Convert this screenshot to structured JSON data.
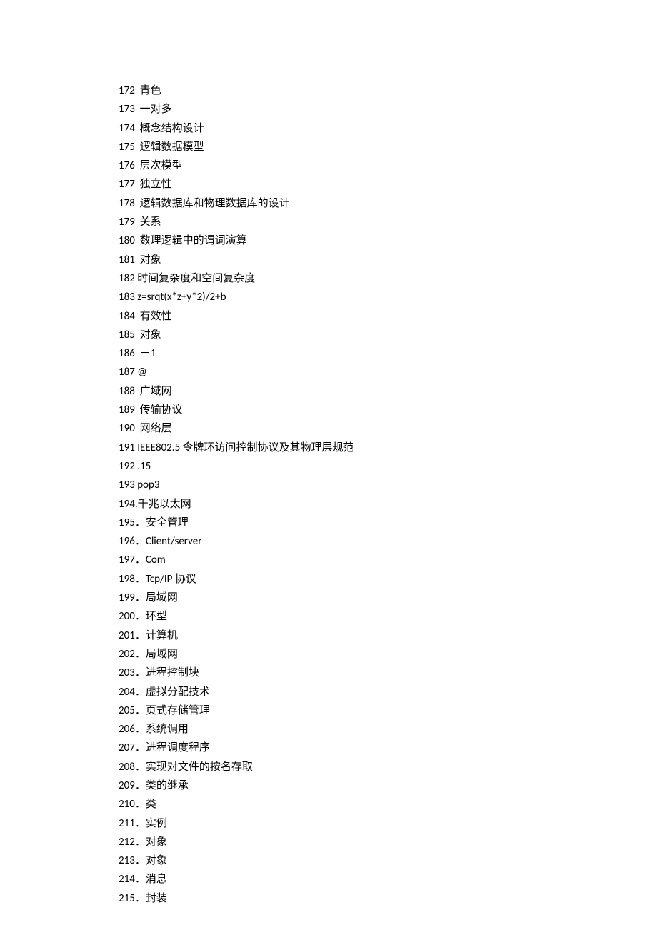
{
  "items": [
    {
      "num": "172",
      "sep": "  ",
      "text": "青色"
    },
    {
      "num": "173",
      "sep": "  ",
      "text": "一对多"
    },
    {
      "num": "174",
      "sep": "  ",
      "text": "概念结构设计"
    },
    {
      "num": "175",
      "sep": "  ",
      "text": "逻辑数据模型"
    },
    {
      "num": "176",
      "sep": "  ",
      "text": "层次模型"
    },
    {
      "num": "177",
      "sep": "  ",
      "text": "独立性"
    },
    {
      "num": "178",
      "sep": "  ",
      "text": "逻辑数据库和物理数据库的设计"
    },
    {
      "num": "179",
      "sep": "  ",
      "text": "关系"
    },
    {
      "num": "180",
      "sep": "  ",
      "text": "数理逻辑中的谓词演算"
    },
    {
      "num": "181",
      "sep": "  ",
      "text": "对象"
    },
    {
      "num": "182",
      "sep": " ",
      "text": "时间复杂度和空间复杂度"
    },
    {
      "num": "183",
      "sep": " ",
      "text": "z=srqt(x*z+y*2)/2+b"
    },
    {
      "num": "184",
      "sep": "  ",
      "text": "有效性"
    },
    {
      "num": "185",
      "sep": "  ",
      "text": "对象"
    },
    {
      "num": "186",
      "sep": "  ",
      "text": "－1"
    },
    {
      "num": "187",
      "sep": " ",
      "text": "@"
    },
    {
      "num": "188",
      "sep": "  ",
      "text": "广域网"
    },
    {
      "num": "189",
      "sep": "  ",
      "text": "传输协议"
    },
    {
      "num": "190",
      "sep": "  ",
      "text": "网络层"
    },
    {
      "num": "191",
      "sep": " ",
      "text": "IEEE802.5 令牌环访问控制协议及其物理层规范"
    },
    {
      "num": "192",
      "sep": " ",
      "text": ".15"
    },
    {
      "num": "193",
      "sep": " ",
      "text": "pop3"
    },
    {
      "num": "194",
      "sep": ".",
      "text": "千兆以太网"
    },
    {
      "num": "195",
      "sep": "．",
      "text": "安全管理"
    },
    {
      "num": "196",
      "sep": "．",
      "text": "Client/server"
    },
    {
      "num": "197",
      "sep": "．",
      "text": "Com"
    },
    {
      "num": "198",
      "sep": "．",
      "text": "Tcp/IP 协议"
    },
    {
      "num": "199",
      "sep": "．",
      "text": "局域网"
    },
    {
      "num": "200",
      "sep": "．",
      "text": "环型"
    },
    {
      "num": "201",
      "sep": "．",
      "text": "计算机"
    },
    {
      "num": "202",
      "sep": "．",
      "text": "局域网"
    },
    {
      "num": "203",
      "sep": "．",
      "text": "进程控制块"
    },
    {
      "num": "204",
      "sep": "．",
      "text": "虚拟分配技术"
    },
    {
      "num": "205",
      "sep": "．",
      "text": "页式存储管理"
    },
    {
      "num": "206",
      "sep": "．",
      "text": "系统调用"
    },
    {
      "num": "207",
      "sep": "．",
      "text": "进程调度程序"
    },
    {
      "num": "208",
      "sep": "．",
      "text": "实现对文件的按名存取"
    },
    {
      "num": "209",
      "sep": "．",
      "text": "类的继承"
    },
    {
      "num": "210",
      "sep": "．",
      "text": "类"
    },
    {
      "num": "211",
      "sep": "．",
      "text": "实例"
    },
    {
      "num": "212",
      "sep": "．",
      "text": "对象"
    },
    {
      "num": "213",
      "sep": "．",
      "text": "对象"
    },
    {
      "num": "214",
      "sep": "．",
      "text": "消息"
    },
    {
      "num": "215",
      "sep": "．",
      "text": "封装"
    }
  ]
}
